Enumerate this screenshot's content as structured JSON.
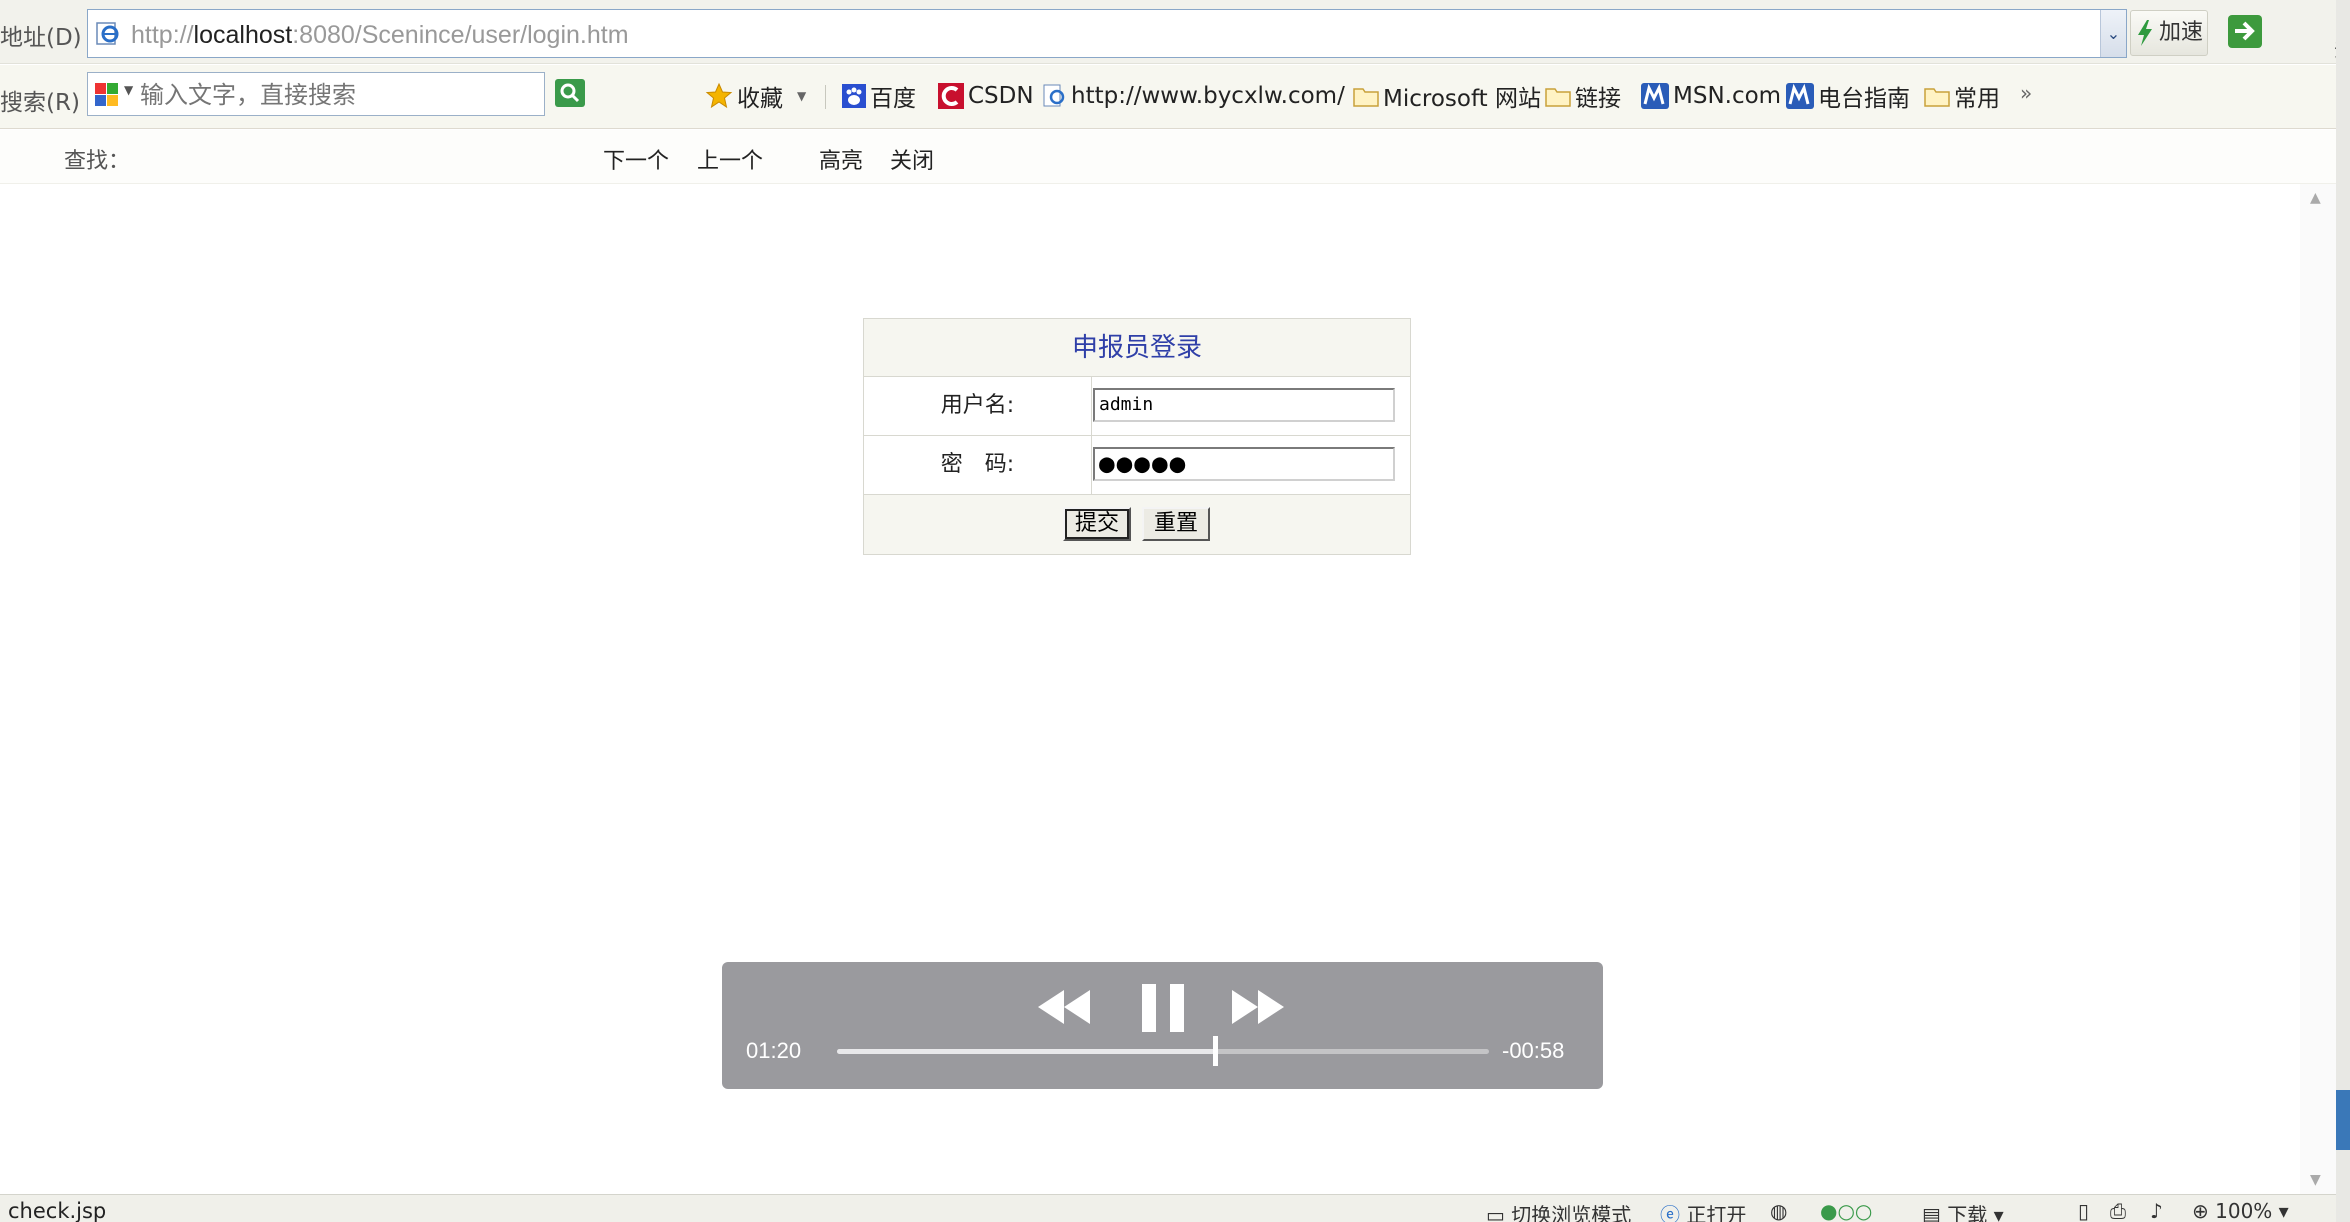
{
  "address_bar": {
    "label": "地址(D)",
    "url_prefix": "http://",
    "url_host": "localhost",
    "url_rest": ":8080/Scenince/user/login.htm",
    "speed_label": "加速"
  },
  "edge_text": "动",
  "search_bar": {
    "label": "搜索(R)",
    "placeholder": "输入文字，直接搜索"
  },
  "favorites": [
    {
      "label": "收藏",
      "icon": "star-icon"
    },
    {
      "label": "百度",
      "icon": "baidu-icon"
    },
    {
      "label": "CSDN",
      "icon": "csdn-icon"
    },
    {
      "label": "http://www.bycxlw.com/",
      "icon": "ie-page-icon"
    },
    {
      "label": "Microsoft 网站",
      "icon": "folder-icon"
    },
    {
      "label": "链接",
      "icon": "folder-icon"
    },
    {
      "label": "MSN.com",
      "icon": "msn-icon"
    },
    {
      "label": "电台指南",
      "icon": "msn-icon"
    },
    {
      "label": "常用",
      "icon": "folder-icon"
    }
  ],
  "more_chevron": "»",
  "find_bar": {
    "label": "查找：",
    "next": "下一个",
    "prev": "上一个",
    "highlight": "高亮",
    "close": "关闭"
  },
  "login": {
    "title": "申报员登录",
    "username_label": "用户名:",
    "username_value": "admin",
    "password_label": "密　码:",
    "password_value": "●●●●●",
    "submit_label": "提交",
    "reset_label": "重置"
  },
  "player": {
    "elapsed": "01:20",
    "remaining": "-00:58",
    "progress": 0.58
  },
  "status_bar": {
    "text": "check.jsp",
    "switch_mode": "切换浏览模式",
    "reopen": "正打开",
    "download": "下载",
    "zoom": "100%"
  },
  "colors": {
    "title_blue": "#2f3fa8",
    "go_green": "#3d9a3d"
  }
}
